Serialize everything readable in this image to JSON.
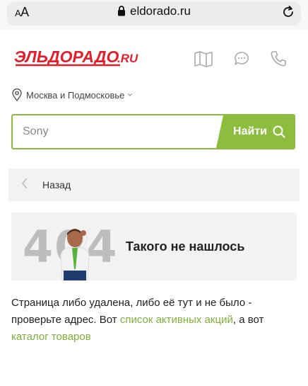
{
  "browser": {
    "aa_small": "A",
    "aa_large": "A",
    "url": "eldorado.ru"
  },
  "header": {
    "logo_text": "ЭЛЬДОРАДО",
    "logo_suffix": ".RU",
    "icons": [
      "map-icon",
      "chat-icon",
      "phone-icon"
    ]
  },
  "region": {
    "label": "Москва и Подмосковье"
  },
  "search": {
    "placeholder": "Sony",
    "button_label": "Найти"
  },
  "back": {
    "label": "Назад"
  },
  "error": {
    "code": "404",
    "title": "Такого не нашлось"
  },
  "message": {
    "text_before": "Страница либо удалена, либо её тут и не было - проверьте адрес. Вот ",
    "link1": "список активных акций",
    "text_middle": ", а вот ",
    "link2": "каталог товаров"
  },
  "colors": {
    "brand_red": "#e21f2b",
    "accent_green": "#8cbd3f",
    "link_green": "#7db037"
  }
}
